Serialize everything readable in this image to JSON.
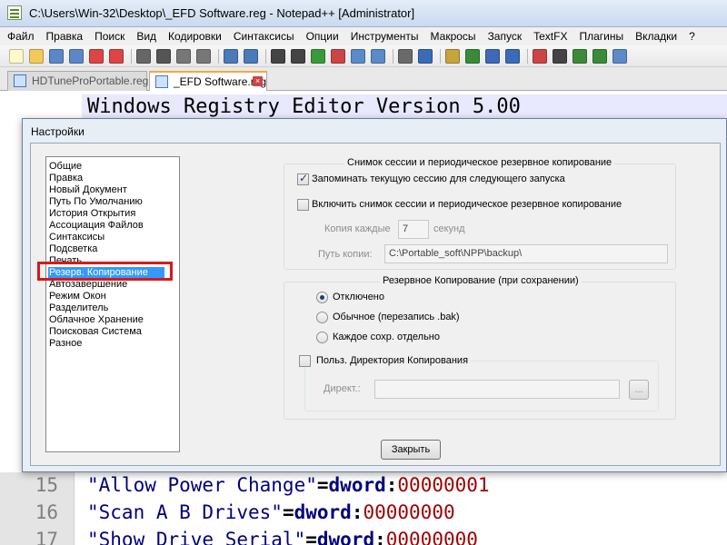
{
  "window": {
    "title": "C:\\Users\\Win-32\\Desktop\\_EFD Software.reg - Notepad++ [Administrator]"
  },
  "menu": [
    "Файл",
    "Правка",
    "Поиск",
    "Вид",
    "Кодировки",
    "Синтаксисы",
    "Опции",
    "Инструменты",
    "Макросы",
    "Запуск",
    "TextFX",
    "Плагины",
    "Вкладки",
    "?"
  ],
  "toolbar_icons": [
    "new-file-icon",
    "open-file-icon",
    "save-icon",
    "save-all-icon",
    "close-icon",
    "close-all-icon",
    "print-icon",
    "cut-icon",
    "copy-icon",
    "paste-icon",
    "undo-icon",
    "redo-icon",
    "find-icon",
    "replace-icon",
    "zoom-in-icon",
    "zoom-out-icon",
    "sync-v-icon",
    "sync-h-icon",
    "wrap-icon",
    "show-all-icon",
    "indent-guide-icon",
    "doc-map-icon",
    "function-list-icon",
    "folder-as-workspace-icon",
    "record-macro-icon",
    "stop-record-icon",
    "play-macro-icon",
    "run-macro-icon",
    "save-macro-icon"
  ],
  "tabs": [
    {
      "label": "HDTuneProPortable.reg",
      "active": false
    },
    {
      "label": "_EFD Software.reg",
      "active": true
    }
  ],
  "editor": {
    "top_line": "Windows Registry Editor Version 5.00",
    "lines": [
      {
        "number": "15",
        "key": "\"Allow Power Change\"",
        "op": "=",
        "type": "dword",
        "colon": ":",
        "value": "00000001"
      },
      {
        "number": "16",
        "key": "\"Scan A B Drives\"",
        "op": "=",
        "type": "dword",
        "colon": ":",
        "value": "00000000"
      },
      {
        "number": "17",
        "key": "\"Show Drive Serial\"",
        "op": "=",
        "type": "dword",
        "colon": ":",
        "value": "00000000"
      }
    ]
  },
  "dialog": {
    "title": "Настройки",
    "categories": [
      "Общие",
      "Правка",
      "Новый Документ",
      "Путь По Умолчанию",
      "История Открытия",
      "Ассоциация Файлов",
      "Синтаксисы",
      "Подсветка",
      "Печать",
      "Резерв. Копирование",
      "Автозавершение",
      "Режим Окон",
      "Разделитель",
      "Облачное Хранение",
      "Поисковая Система",
      "Разное"
    ],
    "selected_category": "Резерв. Копирование",
    "session": {
      "group_title": "Снимок сессии и периодическое резервное копирование",
      "remember_label": "Запоминать текущую сессию для следующего запуска",
      "remember_checked": true,
      "snapshot_label": "Включить снимок сессии и периодическое резервное копирование",
      "snapshot_checked": false,
      "copy_every_label": "Копия каждые",
      "copy_every_value": "7",
      "seconds_label": "секунд",
      "path_label": "Путь копии:",
      "path_value": "C:\\Portable_soft\\NPP\\backup\\"
    },
    "backup": {
      "group_title": "Резервное Копирование (при сохранении)",
      "options": [
        {
          "label": "Отключено",
          "checked": true
        },
        {
          "label": "Обычное (перезапись .bak)",
          "checked": false
        },
        {
          "label": "Каждое сохр. отдельно",
          "checked": false
        }
      ],
      "custom_dir_label": "Польз. Директория Копирования",
      "custom_dir_checked": false,
      "dir_label": "Директ.:",
      "dir_value": "",
      "browse_label": "..."
    },
    "close_label": "Закрыть"
  }
}
